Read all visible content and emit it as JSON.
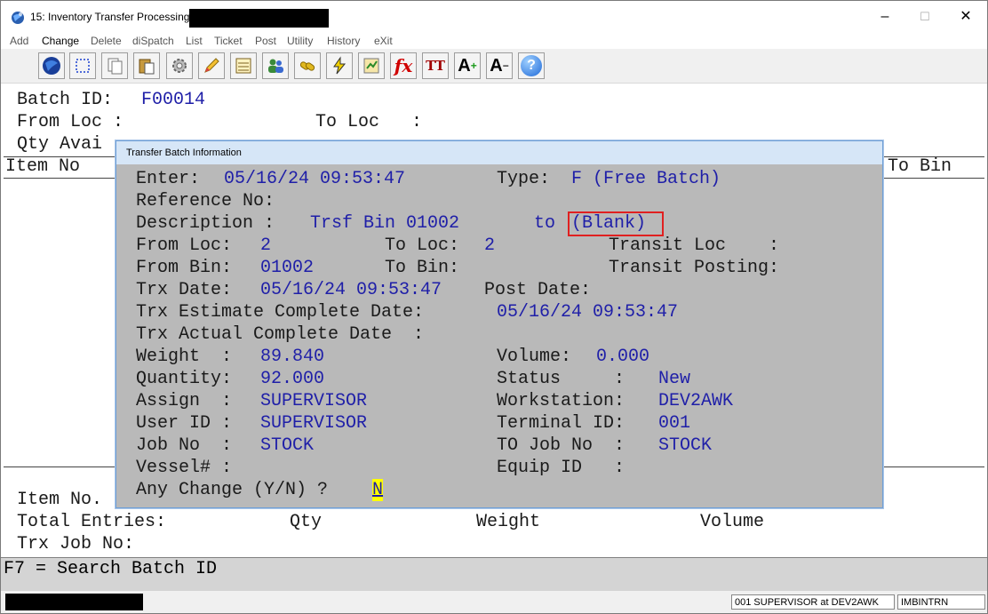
{
  "window": {
    "title": "15: Inventory Transfer Processing -",
    "minimize": "–",
    "maximize": "☐",
    "close": "✕"
  },
  "menu": [
    "Add",
    "Change",
    "Delete",
    "diSpatch",
    "List",
    "Ticket",
    "Post",
    "Utility",
    "History",
    "eXit"
  ],
  "toolbar": {
    "icons": [
      "globe-icon",
      "select-icon",
      "copy-icon",
      "paste-icon",
      "settings-icon",
      "edit-icon",
      "form-icon",
      "users-icon",
      "link-icon",
      "lightning-icon",
      "calc-icon",
      "fx-icon",
      "font-size-icon",
      "font-increase-icon",
      "font-decrease-icon",
      "help-icon"
    ],
    "fx": "fx",
    "tt": "TT",
    "a_plus": "A",
    "a_minus": "A",
    "help": "?"
  },
  "screen": {
    "batch_id_label": "Batch ID:",
    "batch_id_value": "F00014",
    "from_loc_label": "From Loc :",
    "to_loc_label": "To Loc   :",
    "qty_avail_label": "Qty Avai",
    "item_no_header": "Item No",
    "to_bin_header": "To Bin",
    "item_no_footer": "Item No.",
    "total_entries_label": "Total Entries:",
    "qty_label": "Qty",
    "weight_label": "Weight",
    "volume_label": "Volume",
    "trx_job_label": "Trx Job No:"
  },
  "help_line": "F7 = Search Batch ID",
  "status": {
    "user": "001 SUPERVISOR at DEV2AWK",
    "program": "IMBINTRN"
  },
  "dialog": {
    "title": "Transfer Batch Information",
    "enter_label": "Enter:",
    "enter_value": "05/16/24 09:53:47",
    "type_label": "Type:",
    "type_value": "F (Free Batch)",
    "reference_label": "Reference No:",
    "description_label": "Description :",
    "description_value": "Trsf Bin 01002",
    "description_to": "to",
    "description_blank": "(Blank)",
    "from_loc_label": "From Loc:",
    "from_loc_value": "2",
    "to_loc_label": "To Loc:",
    "to_loc_value": "2",
    "transit_loc_label": "Transit Loc    :",
    "from_bin_label": "From Bin:",
    "from_bin_value": "01002",
    "to_bin_label": "To Bin:",
    "transit_posting_label": "Transit Posting:",
    "trx_date_label": "Trx Date:",
    "trx_date_value": "05/16/24 09:53:47",
    "post_date_label": "Post Date:",
    "est_complete_label": "Trx Estimate Complete Date:",
    "est_complete_value": "05/16/24 09:53:47",
    "actual_complete_label": "Trx Actual Complete Date  :",
    "weight_label": "Weight  :",
    "weight_value": "89.840",
    "volume_label": "Volume:",
    "volume_value": "0.000",
    "quantity_label": "Quantity:",
    "quantity_value": "92.000",
    "status_label": "Status     :",
    "status_value": "New",
    "assign_label": "Assign  :",
    "assign_value": "SUPERVISOR",
    "workstation_label": "Workstation:",
    "workstation_value": "DEV2AWK",
    "user_id_label": "User ID :",
    "user_id_value": "SUPERVISOR",
    "terminal_label": "Terminal ID:",
    "terminal_value": "001",
    "job_label": "Job No  :",
    "job_value": "STOCK",
    "to_job_label": "TO Job No  :",
    "to_job_value": "STOCK",
    "vessel_label": "Vessel# :",
    "equip_label": "Equip ID   :",
    "any_change_label": "Any Change (Y/N) ?",
    "any_change_value": "N"
  }
}
